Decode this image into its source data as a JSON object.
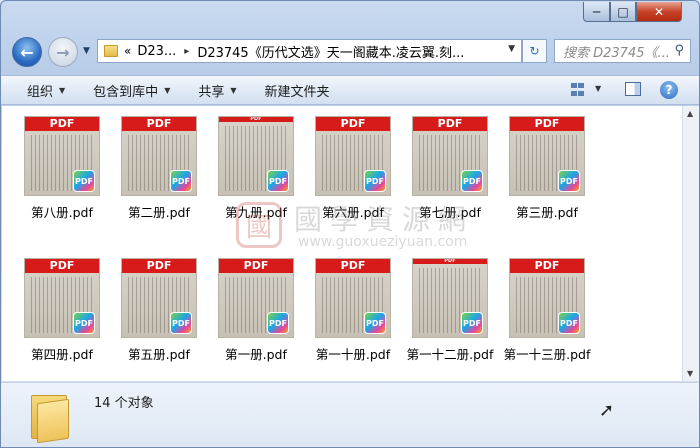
{
  "window": {
    "controls": {
      "minimize": "─",
      "maximize": "□",
      "close": "✕"
    }
  },
  "nav": {
    "back_icon": "←",
    "forward_icon": "→",
    "history_icon": "▼",
    "breadcrumb": [
      "«",
      "D23...",
      "D23745《历代文选》天一阁藏本.凌云翼.刻..."
    ],
    "address_dropdown": "▼",
    "refresh_icon": "↻",
    "search_placeholder": "搜索 D23745《...",
    "search_icon": "⚲"
  },
  "toolbar": {
    "organize": "组织",
    "include_library": "包含到库中",
    "share": "共享",
    "new_folder": "新建文件夹",
    "dropdown_arrow": "▼",
    "help": "?"
  },
  "files": [
    {
      "name": "第八册.pdf",
      "thumb_label": "PDF",
      "badge": "PDF"
    },
    {
      "name": "第二册.pdf",
      "thumb_label": "PDF",
      "badge": "PDF"
    },
    {
      "name": "第九册.pdf",
      "thumb_label": "PDF",
      "badge": "PDF"
    },
    {
      "name": "第六册.pdf",
      "thumb_label": "PDF",
      "badge": "PDF"
    },
    {
      "name": "第七册.pdf",
      "thumb_label": "PDF",
      "badge": "PDF"
    },
    {
      "name": "第三册.pdf",
      "thumb_label": "PDF",
      "badge": "PDF"
    },
    {
      "name": "第四册.pdf",
      "thumb_label": "PDF",
      "badge": "PDF"
    },
    {
      "name": "第五册.pdf",
      "thumb_label": "PDF",
      "badge": "PDF"
    },
    {
      "name": "第一册.pdf",
      "thumb_label": "PDF",
      "badge": "PDF"
    },
    {
      "name": "第一十册.pdf",
      "thumb_label": "PDF",
      "badge": "PDF"
    },
    {
      "name": "第一十二册.pdf",
      "thumb_label": "PDF",
      "badge": "PDF"
    },
    {
      "name": "第一十三册.pdf",
      "thumb_label": "PDF",
      "badge": "PDF"
    }
  ],
  "watermark": {
    "seal": "國",
    "name": "國學資源網",
    "url": "www.guoxueziyuan.com"
  },
  "status": {
    "count": "14 个对象"
  },
  "colors": {
    "pdf_band": "#d71a1a",
    "accent": "#2b6cc2"
  }
}
